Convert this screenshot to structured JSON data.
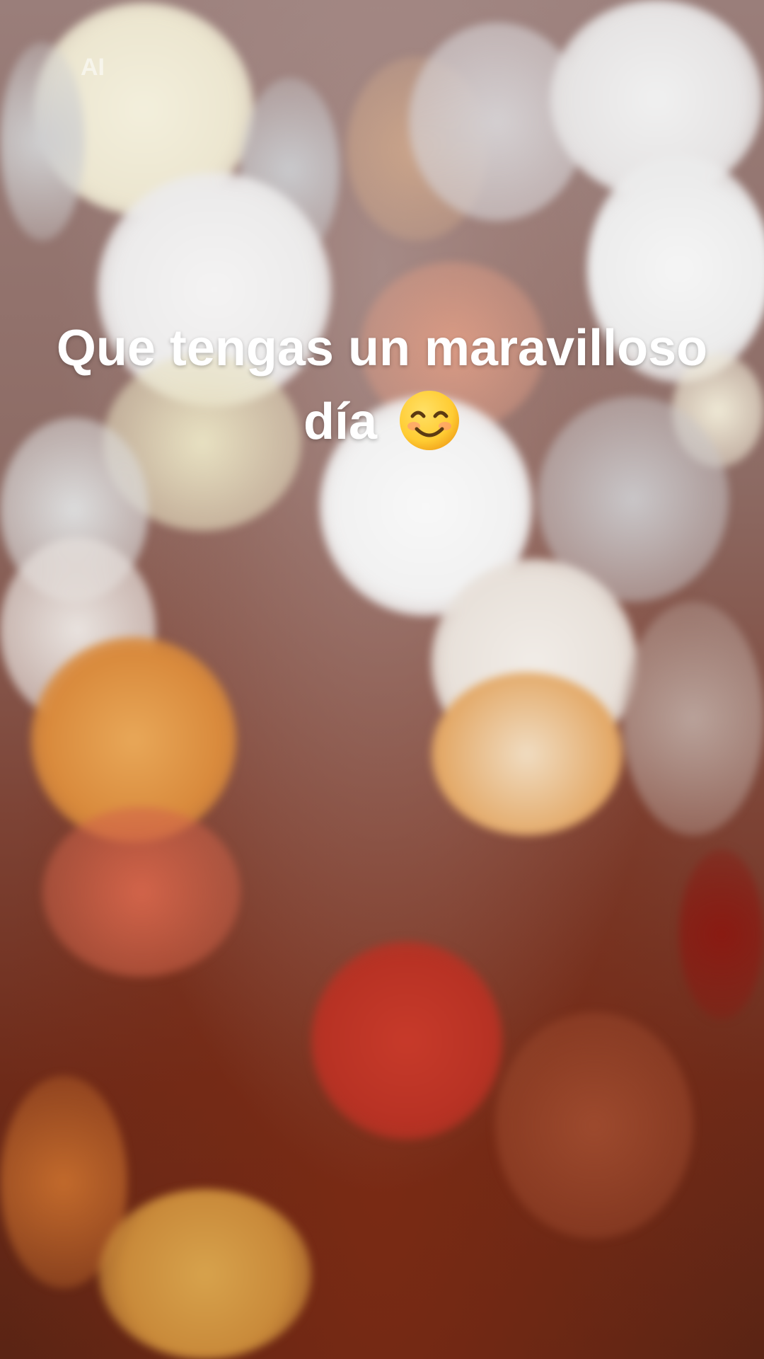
{
  "watermark": {
    "label": "AI"
  },
  "caption": {
    "line1": "Que tengas un maravilloso",
    "line2": "día",
    "emoji_icon": "smiling-face-with-smiling-eyes-icon"
  },
  "colors": {
    "caption_text": "#ffffff",
    "bokeh_white": "#f4f2ee",
    "bokeh_warm": "#e8a24a",
    "bokeh_red": "#c0392b",
    "emoji_face": "#ffcc33"
  }
}
